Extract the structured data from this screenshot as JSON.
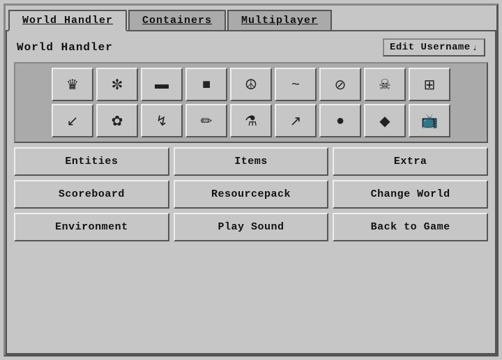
{
  "tabs": [
    {
      "label": "World Handler",
      "active": true
    },
    {
      "label": "Containers",
      "active": false
    },
    {
      "label": "Multiplayer",
      "active": false
    }
  ],
  "header": {
    "title": "World Handler",
    "edit_username_label": "Edit Username",
    "edit_username_icon": "♩"
  },
  "icon_rows": [
    [
      {
        "icon": "♛",
        "name": "crown"
      },
      {
        "icon": "✼",
        "name": "sparkle"
      },
      {
        "icon": "▬",
        "name": "minus"
      },
      {
        "icon": "■",
        "name": "square"
      },
      {
        "icon": "☮",
        "name": "peace"
      },
      {
        "icon": "~",
        "name": "tilde"
      },
      {
        "icon": "⊘",
        "name": "no-entry"
      },
      {
        "icon": "☠",
        "name": "skull"
      },
      {
        "icon": "⊞",
        "name": "grid"
      }
    ],
    [
      {
        "icon": "↙",
        "name": "arrow-down-left"
      },
      {
        "icon": "✿",
        "name": "flower"
      },
      {
        "icon": "↯",
        "name": "lightning"
      },
      {
        "icon": "✏",
        "name": "pencil"
      },
      {
        "icon": "⚗",
        "name": "flask"
      },
      {
        "icon": "↗",
        "name": "arrow-up-right"
      },
      {
        "icon": "●",
        "name": "circle"
      },
      {
        "icon": "◆",
        "name": "diamond"
      },
      {
        "icon": "📺",
        "name": "tv"
      }
    ]
  ],
  "action_rows": [
    [
      {
        "label": "Entities",
        "name": "entities-button"
      },
      {
        "label": "Items",
        "name": "items-button"
      },
      {
        "label": "Extra",
        "name": "extra-button"
      }
    ],
    [
      {
        "label": "Scoreboard",
        "name": "scoreboard-button"
      },
      {
        "label": "Resourcepack",
        "name": "resourcepack-button"
      },
      {
        "label": "Change World",
        "name": "change-world-button"
      }
    ],
    [
      {
        "label": "Environment",
        "name": "environment-button"
      },
      {
        "label": "Play Sound",
        "name": "play-sound-button"
      },
      {
        "label": "Back to Game",
        "name": "back-to-game-button"
      }
    ]
  ]
}
